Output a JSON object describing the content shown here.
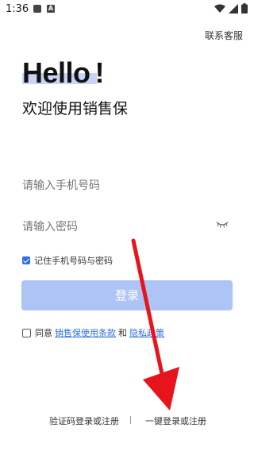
{
  "status_bar": {
    "time": "1:36",
    "icon_a": "A"
  },
  "header": {
    "service_label": "联系客服"
  },
  "hero": {
    "title": "Hello",
    "exclaim": "!",
    "subtitle": "欢迎使用销售保"
  },
  "form": {
    "phone_placeholder": "请输入手机号码",
    "password_placeholder": "请输入密码",
    "remember_label": "记住手机号码与密码",
    "remember_checked": true,
    "login_label": "登录"
  },
  "agreement": {
    "prefix": "同意",
    "terms_link": "销售保使用条款",
    "conjunction": "和",
    "privacy_link": "隐私政策"
  },
  "footer": {
    "sms_login": "验证码登录或注册",
    "one_click_login": "一键登录或注册"
  },
  "colors": {
    "accent": "#2f6fe4",
    "login_button": "#aec4f5",
    "annotation_arrow": "#e8141b"
  }
}
